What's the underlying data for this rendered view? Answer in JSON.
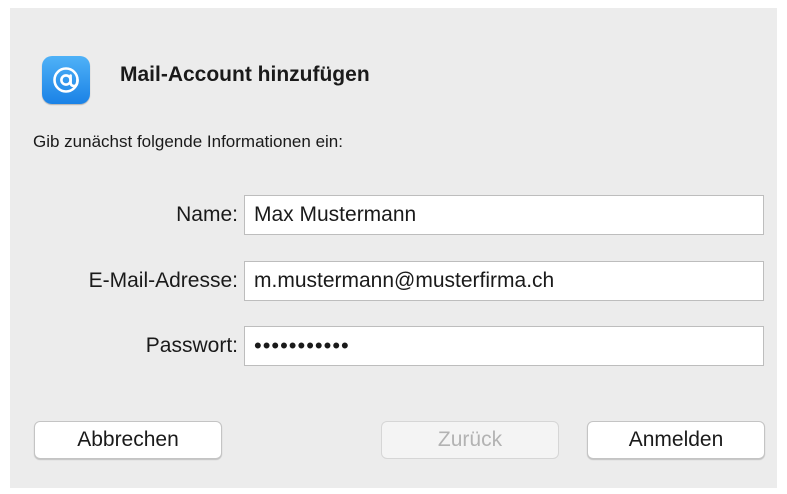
{
  "dialog": {
    "title": "Mail-Account hinzufügen",
    "subtitle": "Gib zunächst folgende Informationen ein:",
    "icon": "at-sign-icon",
    "accent_color": "#1a82e6"
  },
  "form": {
    "name_label": "Name:",
    "name_value": "Max Mustermann",
    "email_label": "E-Mail-Adresse:",
    "email_value": "m.mustermann@musterfirma.ch",
    "password_label": "Passwort:",
    "password_value": "•••••••••••"
  },
  "buttons": {
    "cancel_label": "Abbrechen",
    "back_label": "Zurück",
    "back_enabled": false,
    "login_label": "Anmelden"
  }
}
